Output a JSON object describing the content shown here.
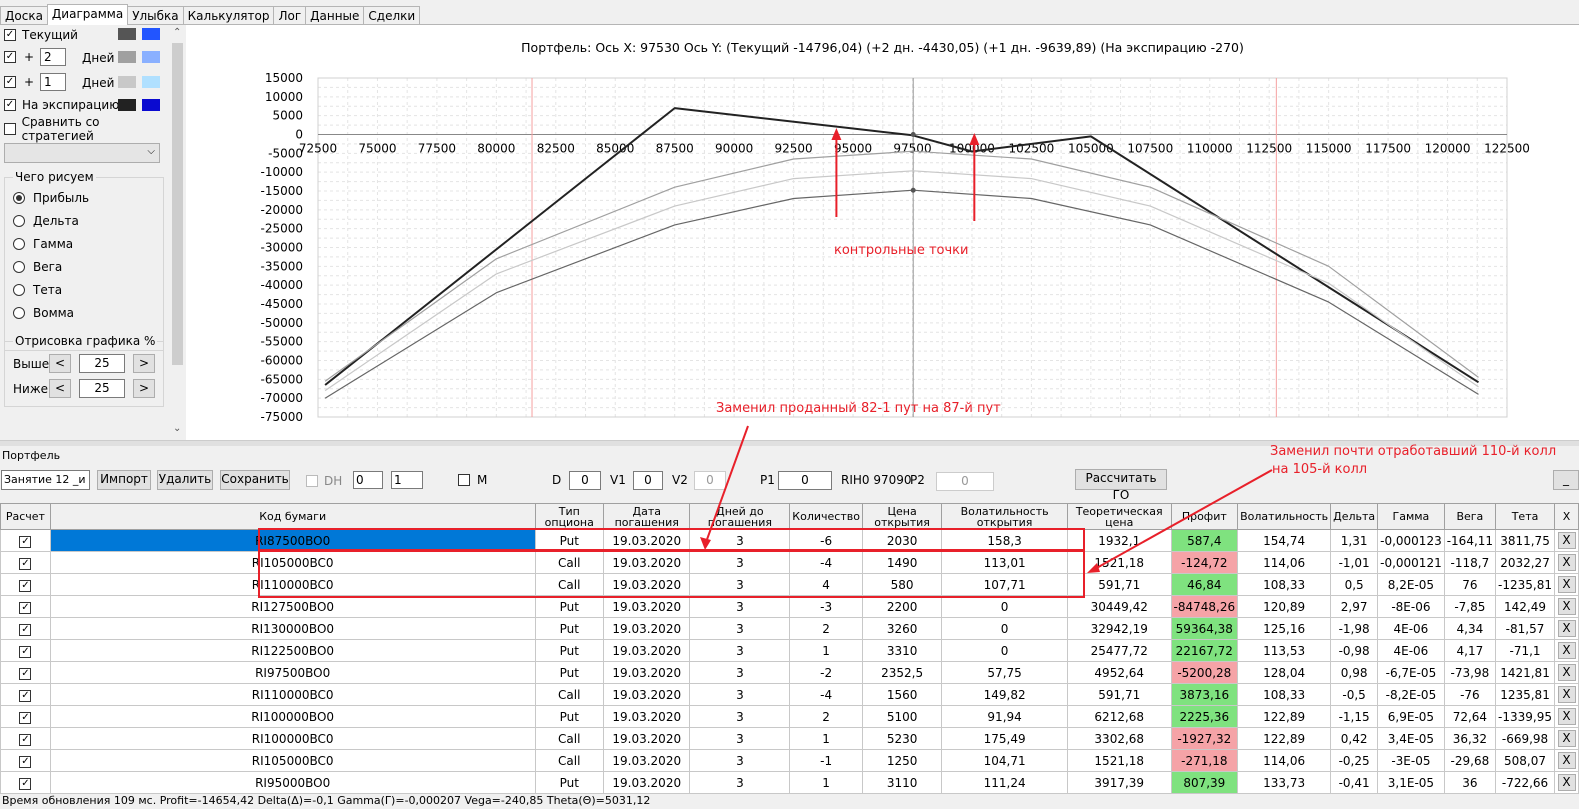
{
  "tabs": [
    "Доска",
    "Диаграмма",
    "Улыбка",
    "Калькулятор",
    "Лог",
    "Данные",
    "Сделки"
  ],
  "active_tab": "Диаграмма",
  "left_panel": {
    "series": [
      {
        "label": "Текущий",
        "checked": true,
        "color1": "#555555",
        "color2": "#2255ff"
      },
      {
        "prefix": "+",
        "days": "2",
        "suffix": "Дней",
        "checked": true,
        "color1": "#a0a0a0",
        "color2": "#8ab0ff"
      },
      {
        "prefix": "+",
        "days": "1",
        "suffix": "Дней",
        "checked": true,
        "color1": "#c8c8c8",
        "color2": "#b0e0ff"
      },
      {
        "label": "На экспирацию",
        "checked": true,
        "color1": "#222222",
        "color2": "#0a0ad0"
      }
    ],
    "compare_label": "Сравнить со стратегией",
    "draw_group_title": "Чего рисуем",
    "draw_options": [
      "Прибыль",
      "Дельта",
      "Гамма",
      "Вега",
      "Тета",
      "Вомма"
    ],
    "draw_selected": "Прибыль",
    "render_group_title": "Отрисовка графика %",
    "above_label": "Выше",
    "above_value": "25",
    "below_label": "Ниже",
    "below_value": "25",
    "left_arrow": "<",
    "right_arrow": ">"
  },
  "chart_title": "Портфель: Ось X: 97530 Ось Y:  (Текущий -14796,04)  (+2 дн. -4430,05)  (+1 дн. -9639,89)  (На экспирацию -270)",
  "chart_data": {
    "type": "line",
    "xlim": [
      72500,
      122500
    ],
    "ylim": [
      -75000,
      15000
    ],
    "x_ticks": [
      72500,
      75000,
      77500,
      80000,
      82500,
      85000,
      87500,
      90000,
      92500,
      95000,
      97500,
      100000,
      102500,
      105000,
      107500,
      110000,
      112500,
      115000,
      117500,
      120000,
      122500
    ],
    "y_ticks": [
      15000,
      10000,
      5000,
      0,
      -5000,
      -10000,
      -15000,
      -20000,
      -25000,
      -30000,
      -35000,
      -40000,
      -45000,
      -50000,
      -55000,
      -60000,
      -65000,
      -70000,
      -75000
    ],
    "vlines_red": [
      81500,
      112800
    ],
    "vline_gray": 97530,
    "series": [
      {
        "color": "#222222",
        "x": [
          72800,
          87500,
          97500,
          100000,
          105000,
          121300
        ],
        "y": [
          -66500,
          7000,
          -200,
          -4500,
          -500,
          -65800
        ]
      },
      {
        "color": "#a0a0a0",
        "x": [
          72800,
          80000,
          87500,
          92500,
          97530,
          102500,
          107500,
          115000,
          121300
        ],
        "y": [
          -65500,
          -33000,
          -14000,
          -6500,
          -4430,
          -6500,
          -14000,
          -35000,
          -64500
        ]
      },
      {
        "color": "#c8c8c8",
        "x": [
          72800,
          80000,
          87500,
          92500,
          97530,
          102500,
          107500,
          115000,
          121300
        ],
        "y": [
          -68000,
          -37000,
          -19000,
          -11700,
          -9640,
          -11700,
          -19000,
          -39500,
          -67000
        ]
      },
      {
        "color": "#666666",
        "x": [
          72800,
          80000,
          87500,
          92500,
          97530,
          102500,
          107500,
          115000,
          121300
        ],
        "y": [
          -70000,
          -42000,
          -24000,
          -17000,
          -14796,
          -17000,
          -24000,
          -44500,
          -69000
        ]
      }
    ]
  },
  "portfolio_label": "Портфель",
  "toolbar": {
    "session": "Занятие 12 _и",
    "import": "Импорт",
    "delete": "Удалить",
    "save": "Сохранить",
    "dh": "DH",
    "spin1": "0",
    "spin2": "1",
    "m": "M",
    "d": "D",
    "d_val": "0",
    "v1": "V1",
    "v1_val": "0",
    "v2": "V2",
    "v2_val": "0",
    "p1": "P1",
    "p1_val": "0",
    "rih": "RIH0 97090",
    "p2": "P2",
    "p2_val": "0",
    "calc_go": "Рассчитать ГО"
  },
  "table": {
    "headers": [
      "Расчет",
      "Код бумаги",
      "Тип опциона",
      "Дата погашения",
      "Дней до погашения",
      "Количество",
      "Цена открытия",
      "Волатильность открытия",
      "Теоретическая цена",
      "Профит",
      "Волатильность",
      "Дельта",
      "Гамма",
      "Вега",
      "Тета",
      "X"
    ],
    "rows": [
      [
        "RI87500BO0",
        "Put",
        "19.03.2020",
        "3",
        "-6",
        "2030",
        "158,3",
        "1932,1",
        "587,4",
        "154,74",
        "1,31",
        "-0,000123",
        "-164,11",
        "3811,75",
        "X"
      ],
      [
        "RI105000BC0",
        "Call",
        "19.03.2020",
        "3",
        "-4",
        "1490",
        "113,01",
        "1521,18",
        "-124,72",
        "114,06",
        "-1,01",
        "-0,000121",
        "-118,7",
        "2032,27",
        "X"
      ],
      [
        "RI110000BC0",
        "Call",
        "19.03.2020",
        "3",
        "4",
        "580",
        "107,71",
        "591,71",
        "46,84",
        "108,33",
        "0,5",
        "8,2E-05",
        "76",
        "-1235,81",
        "X"
      ],
      [
        "RI127500BO0",
        "Put",
        "19.03.2020",
        "3",
        "-3",
        "2200",
        "0",
        "30449,42",
        "-84748,26",
        "120,89",
        "2,97",
        "-8E-06",
        "-7,85",
        "142,49",
        "X"
      ],
      [
        "RI130000BO0",
        "Put",
        "19.03.2020",
        "3",
        "2",
        "3260",
        "0",
        "32942,19",
        "59364,38",
        "125,16",
        "-1,98",
        "4E-06",
        "4,34",
        "-81,57",
        "X"
      ],
      [
        "RI122500BO0",
        "Put",
        "19.03.2020",
        "3",
        "1",
        "3310",
        "0",
        "25477,72",
        "22167,72",
        "113,53",
        "-0,98",
        "4E-06",
        "4,17",
        "-71,1",
        "X"
      ],
      [
        "RI97500BO0",
        "Put",
        "19.03.2020",
        "3",
        "-2",
        "2352,5",
        "57,75",
        "4952,64",
        "-5200,28",
        "128,04",
        "0,98",
        "-6,7E-05",
        "-73,98",
        "1421,81",
        "X"
      ],
      [
        "RI110000BC0",
        "Call",
        "19.03.2020",
        "3",
        "-4",
        "1560",
        "149,82",
        "591,71",
        "3873,16",
        "108,33",
        "-0,5",
        "-8,2E-05",
        "-76",
        "1235,81",
        "X"
      ],
      [
        "RI100000BO0",
        "Put",
        "19.03.2020",
        "3",
        "2",
        "5100",
        "91,94",
        "6212,68",
        "2225,36",
        "122,89",
        "-1,15",
        "6,9E-05",
        "72,64",
        "-1339,95",
        "X"
      ],
      [
        "RI100000BC0",
        "Call",
        "19.03.2020",
        "3",
        "1",
        "5230",
        "175,49",
        "3302,68",
        "-1927,32",
        "122,89",
        "0,42",
        "3,4E-05",
        "36,32",
        "-669,98",
        "X"
      ],
      [
        "RI105000BC0",
        "Call",
        "19.03.2020",
        "3",
        "-1",
        "1250",
        "104,71",
        "1521,18",
        "-271,18",
        "114,06",
        "-0,25",
        "-3E-05",
        "-29,68",
        "508,07",
        "X"
      ],
      [
        "RI95000BO0",
        "Put",
        "19.03.2020",
        "3",
        "1",
        "3110",
        "111,24",
        "3917,39",
        "807,39",
        "133,73",
        "-0,41",
        "3,1E-05",
        "36",
        "-722,66",
        "X"
      ]
    ]
  },
  "status": "Время обновления 109 мс. Profit=-14654,42 Delta(Δ)=-0,1 Gamma(Γ)=-0,000207 Vega=-240,85 Theta(Θ)=5031,12",
  "annotations": {
    "control_points": "контрольные точки",
    "replaced_put": "Заменил проданный 82-1 пут на 87-й пут",
    "replaced_call_1": "Заменил почти отработавший 110-й колл",
    "replaced_call_2": "на 105-й колл"
  },
  "colors": {
    "annotation": "#e8202a",
    "selected": "#0078d7",
    "profit_pos": "#7fe27f",
    "profit_neg": "#f5a3a7"
  }
}
